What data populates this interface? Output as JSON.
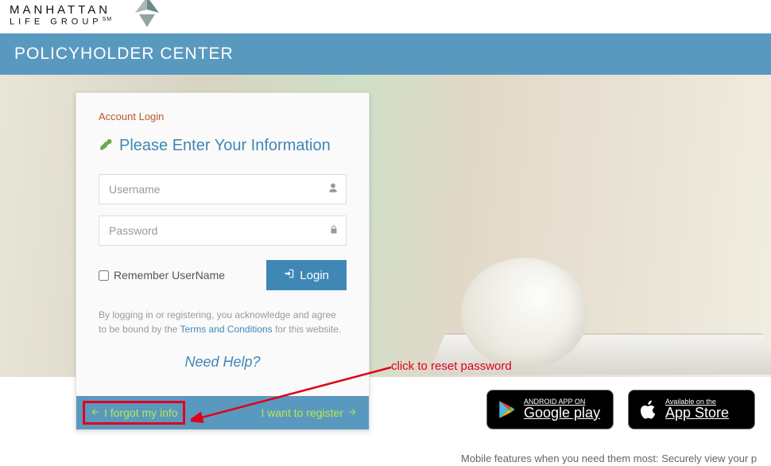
{
  "brand": {
    "line1": "MANHATTAN",
    "line2": "LIFE GROUP",
    "suffix": "SM"
  },
  "header": {
    "title": "POLICYHOLDER CENTER"
  },
  "login": {
    "card_title": "Account Login",
    "heading": "Please Enter Your Information",
    "username_placeholder": "Username",
    "password_placeholder": "Password",
    "remember_label": "Remember UserName",
    "login_button_label": "Login",
    "disclaimer_pre": "By logging in or registering, you acknowledge and agree to be bound by the ",
    "terms_link": "Terms and Conditions",
    "disclaimer_post": " for this website.",
    "need_help": "Need Help?",
    "forgot_label": "I forgot my info",
    "register_label": "I want to register"
  },
  "annotation": {
    "text": "click to reset password"
  },
  "stores": {
    "google_small": "ANDROID APP ON",
    "google_big": "Google play",
    "apple_small": "Available on the",
    "apple_big": "App Store"
  },
  "mobile_tagline": "Mobile features when you need them most: Securely view your p"
}
